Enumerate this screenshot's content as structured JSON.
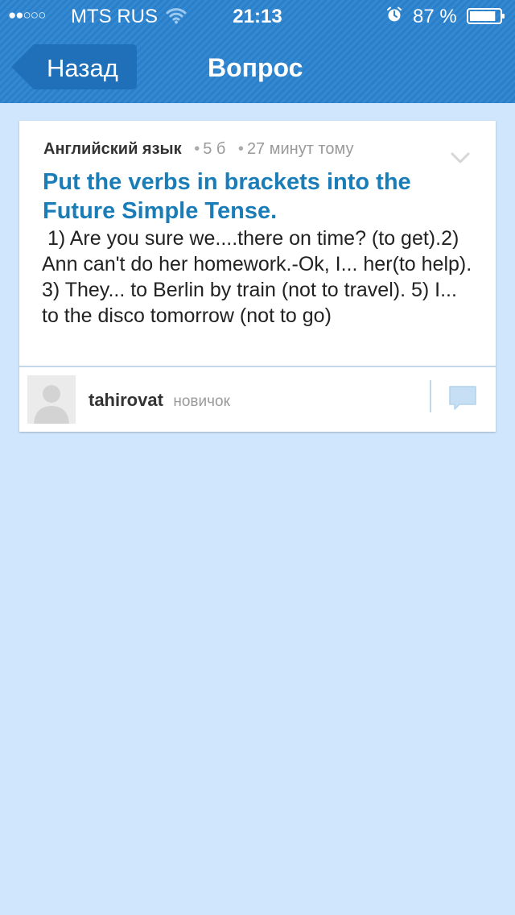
{
  "status_bar": {
    "signal": "●●○○○",
    "carrier": "MTS RUS",
    "time": "21:13",
    "battery_percent": "87 %",
    "battery_level": 0.87
  },
  "nav": {
    "back_label": "Назад",
    "title": "Вопрос"
  },
  "question": {
    "subject": "Английский язык",
    "points": "5 б",
    "posted": "27 минут тому",
    "title": "Put the verbs in brackets into the Future Simple Tense.",
    "body": " 1) Are you sure we....there on time? (to get).2) Ann can't do her homework.-Ok, I... her(to help). 3) They... to Berlin by train (not to travel). 5) I... to the disco tomorrow (not to go)",
    "author": {
      "name": "tahirovat",
      "rank": "новичок"
    }
  },
  "icons": {
    "wifi": "wifi-icon",
    "alarm": "alarm-icon",
    "battery": "battery-icon",
    "expand": "chevron-down-icon",
    "avatar": "user-placeholder-icon",
    "comment": "comment-icon"
  },
  "colors": {
    "header": "#2a83cf",
    "background": "#cfe6fd",
    "title": "#1a7db8",
    "divider": "#c3d8ea"
  }
}
